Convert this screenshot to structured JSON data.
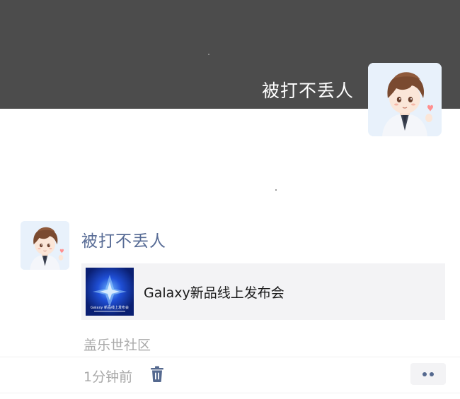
{
  "cover": {
    "user_name": "被打不丢人"
  },
  "post": {
    "author": "被打不丢人",
    "share": {
      "title": "Galaxy新品线上发布会",
      "thumbnail_caption": "Galaxy 新品线上发布会"
    },
    "source": "盖乐世社区",
    "time": "1分钟前"
  },
  "icons": {
    "delete": "trash-icon",
    "more": "more-dots-icon"
  },
  "colors": {
    "cover_background": "#4c4c4c",
    "author_name": "#576b95",
    "muted_text": "#a9a9a9",
    "card_background": "#f3f3f5",
    "action_icon": "#55698f"
  }
}
